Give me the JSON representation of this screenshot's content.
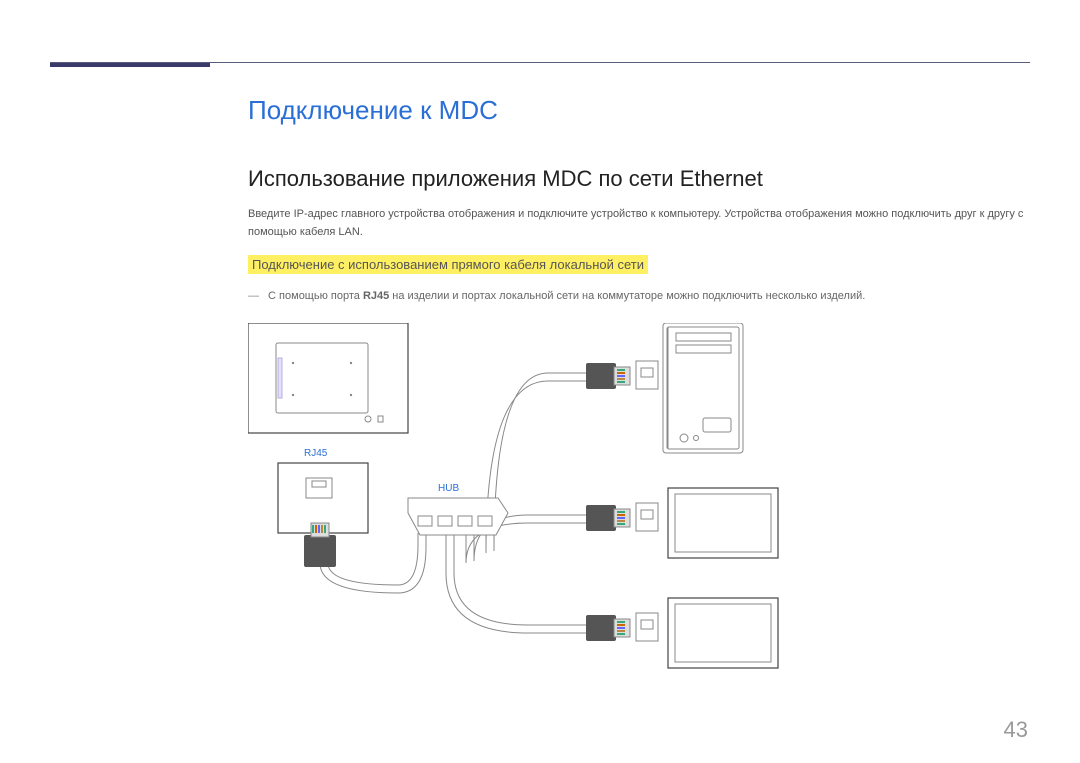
{
  "header": {
    "title": "Подключение к MDC"
  },
  "section": {
    "heading": "Использование приложения MDC по сети Ethernet",
    "para": "Введите IP-адрес главного устройства отображения и подключите устройство к компьютеру. Устройства отображения можно подключить друг к другу с помощью кабеля LAN.",
    "highlight": "Подключение с использованием прямого кабеля локальной сети",
    "note_prefix": "―",
    "note_text_1": " С помощью порта ",
    "note_bold": "RJ45",
    "note_text_2": " на изделии и портах локальной сети на коммутаторе можно подключить несколько изделий."
  },
  "diagram": {
    "rj45_label": "RJ45",
    "hub_label": "HUB"
  },
  "page": {
    "number": "43"
  }
}
